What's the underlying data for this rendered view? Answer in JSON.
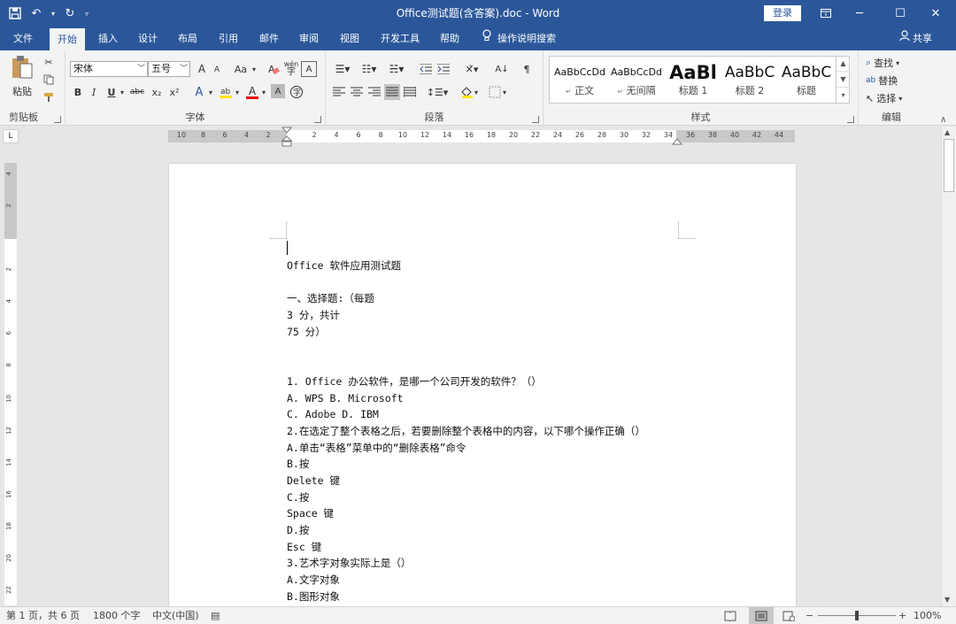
{
  "window": {
    "title": "Office测试题(含答案).doc - Word",
    "login_label": "登录"
  },
  "tabs": [
    {
      "label": "文件"
    },
    {
      "label": "开始"
    },
    {
      "label": "插入"
    },
    {
      "label": "设计"
    },
    {
      "label": "布局"
    },
    {
      "label": "引用"
    },
    {
      "label": "邮件"
    },
    {
      "label": "审阅"
    },
    {
      "label": "视图"
    },
    {
      "label": "开发工具"
    },
    {
      "label": "帮助"
    }
  ],
  "help_search": "操作说明搜索",
  "share": "共享",
  "ribbon": {
    "clipboard": {
      "label": "剪贴板",
      "paste": "粘贴"
    },
    "font": {
      "label": "字体",
      "family": "宋体",
      "size": "五号",
      "grow": "A",
      "shrink": "A",
      "case": "Aa",
      "phonetic": "wén",
      "bold": "B",
      "italic": "I",
      "underline": "U",
      "strike": "abc",
      "sub": "x₂",
      "sup": "x²",
      "effects": "A",
      "color": "A",
      "shade": "A",
      "enclose": "字"
    },
    "paragraph": {
      "label": "段落"
    },
    "styles": {
      "label": "样式",
      "items": [
        {
          "preview": "AaBbCcDd",
          "name": "正文",
          "prefix": "↵"
        },
        {
          "preview": "AaBbCcDd",
          "name": "无间隔",
          "prefix": "↵"
        },
        {
          "preview": "AaBl",
          "name": "标题 1"
        },
        {
          "preview": "AaBbC",
          "name": "标题 2"
        },
        {
          "preview": "AaBbC",
          "name": "标题"
        }
      ]
    },
    "editing": {
      "label": "编辑",
      "find": "查找",
      "replace": "替换",
      "select": "选择"
    }
  },
  "ruler": {
    "h_ticks": [
      "10",
      "8",
      "6",
      "4",
      "2",
      "2",
      "4",
      "6",
      "8",
      "10",
      "12",
      "14",
      "16",
      "18",
      "20",
      "22",
      "24",
      "26",
      "28",
      "30",
      "32",
      "34",
      "36",
      "38",
      "40",
      "42",
      "44"
    ],
    "v_ticks": [
      "4",
      "2",
      "2",
      "4",
      "6",
      "8",
      "10",
      "12",
      "14",
      "16",
      "18",
      "20",
      "22"
    ],
    "corner": "L"
  },
  "document": {
    "lines": [
      "Office 软件应用测试题",
      "",
      "一、选择题:（每题",
      "3 分，共计",
      "75 分）",
      "",
      "",
      "1. Office 办公软件，是哪一个公司开发的软件？（）",
      "A. WPS B. Microsoft",
      "C. Adobe D. IBM",
      "2.在选定了整个表格之后，若要删除整个表格中的内容，以下哪个操作正确（）",
      "A.单击“表格”菜单中的“删除表格”命令",
      "B.按",
      "Delete 键",
      "C.按",
      "Space 键",
      "D.按",
      "Esc 键",
      "3.艺术字对象实际上是（）",
      "A.文字对象",
      "B.图形对象"
    ]
  },
  "status": {
    "page": "第 1 页，共 6 页",
    "words": "1800 个字",
    "lang": "中文(中国)",
    "zoom": "100%",
    "zoom_level": 1.0
  }
}
